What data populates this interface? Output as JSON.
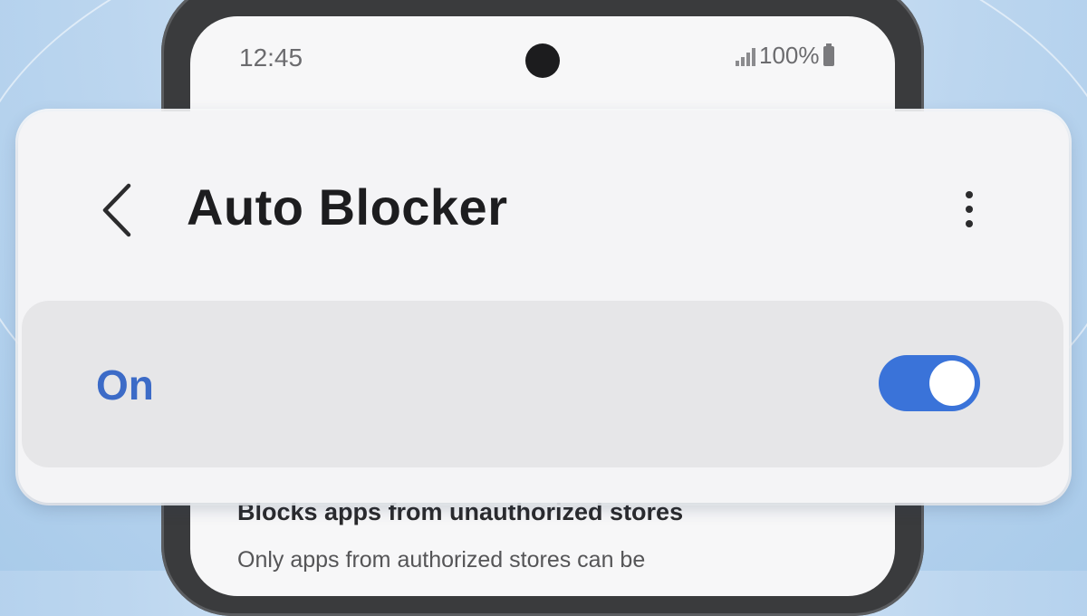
{
  "status_bar": {
    "time": "12:45",
    "battery": "100%",
    "icons": [
      "signal-icon",
      "battery-icon"
    ]
  },
  "header": {
    "title": "Auto Blocker",
    "back_icon": "chevron-left-icon",
    "more_icon": "more-vertical-icon"
  },
  "master_switch": {
    "label": "On",
    "checked": true
  },
  "section": {
    "title": "Blocks apps from unauthorized stores",
    "description": "Only apps from authorized stores can be"
  },
  "colors": {
    "accent": "#3a73d9",
    "label_on": "#3c6bc7"
  }
}
